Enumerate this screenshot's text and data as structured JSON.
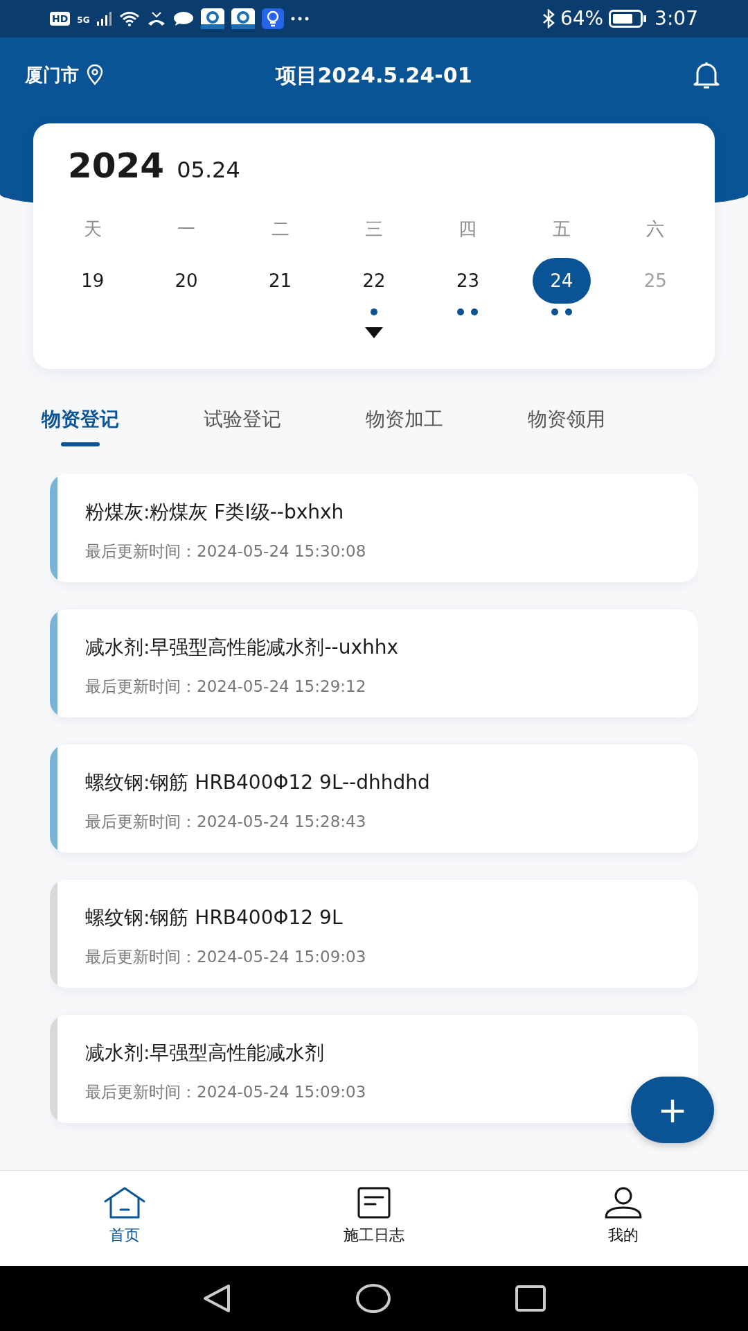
{
  "status_bar": {
    "badges": [
      "HD",
      "5G"
    ],
    "battery": "64%",
    "time": "3:07"
  },
  "header": {
    "city": "厦门市",
    "title": "项目2024.5.24-01"
  },
  "calendar": {
    "year": "2024",
    "date": "05.24",
    "weekdays": [
      "天",
      "一",
      "二",
      "三",
      "四",
      "五",
      "六"
    ],
    "days": [
      {
        "label": "19",
        "selected": false,
        "muted": false,
        "kind": "none"
      },
      {
        "label": "20",
        "selected": false,
        "muted": false,
        "kind": "none"
      },
      {
        "label": "21",
        "selected": false,
        "muted": false,
        "kind": "none"
      },
      {
        "label": "22",
        "selected": false,
        "muted": false,
        "kind": "single"
      },
      {
        "label": "23",
        "selected": false,
        "muted": false,
        "kind": "double"
      },
      {
        "label": "24",
        "selected": true,
        "muted": false,
        "kind": "double"
      },
      {
        "label": "25",
        "selected": false,
        "muted": true,
        "kind": "none"
      }
    ]
  },
  "tabs": [
    {
      "label": "物资登记",
      "selected": true
    },
    {
      "label": "试验登记",
      "selected": false
    },
    {
      "label": "物资加工",
      "selected": false
    },
    {
      "label": "物资领用",
      "selected": false
    }
  ],
  "records": [
    {
      "title": "粉煤灰:粉煤灰 F类I级--bxhxh",
      "updated": "最后更新时间：2024-05-24 15:30:08",
      "color": "#7ab3d6"
    },
    {
      "title": "减水剂:早强型高性能减水剂--uxhhx",
      "updated": "最后更新时间：2024-05-24 15:29:12",
      "color": "#7ab3d6"
    },
    {
      "title": "螺纹钢:钢筋 HRB400Φ12 9L--dhhdhd",
      "updated": "最后更新时间：2024-05-24 15:28:43",
      "color": "#7ab3d6"
    },
    {
      "title": "螺纹钢:钢筋 HRB400Φ12 9L",
      "updated": "最后更新时间：2024-05-24 15:09:03",
      "color": "#d9d9d9"
    },
    {
      "title": "减水剂:早强型高性能减水剂",
      "updated": "最后更新时间：2024-05-24 15:09:03",
      "color": "#d9d9d9"
    }
  ],
  "fab": {
    "label": "+"
  },
  "bottom_nav": [
    {
      "label": "首页",
      "selected": true,
      "kind": "home"
    },
    {
      "label": "施工日志",
      "selected": false,
      "kind": "log"
    },
    {
      "label": "我的",
      "selected": false,
      "kind": "profile"
    }
  ]
}
